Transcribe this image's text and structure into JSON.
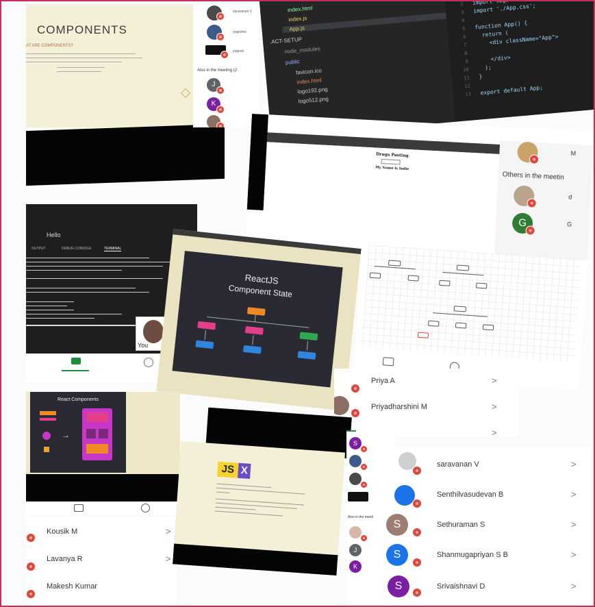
{
  "collage": {
    "components_slide": {
      "title": "COMPONENTS",
      "subtitle": "AT ARE COMPONENTS?",
      "participants": [
        "saravanan V",
        "yogeshw",
        "yogesh"
      ],
      "others_label": "Also in the meeting (2"
    },
    "vscode": {
      "files": [
        "index.html",
        "index.js",
        "App.js",
        ".ACT-SETUP",
        "node_modules",
        "public",
        "favicon.ico",
        "index.html",
        "logo192.png",
        "logo512.png"
      ],
      "code_lines": [
        "import React from 'react';",
        "import logo from './logo.svg",
        "import './App.css';",
        "",
        "function App() {",
        "  return (",
        "    <div className=\"App\">",
        "",
        "    </div>",
        "  );",
        "}",
        "",
        "export default App;"
      ],
      "line_numbers": [
        "1",
        "2",
        "3",
        "4",
        "5",
        "6",
        "7",
        "8",
        "9",
        "10",
        "11",
        "12",
        "13"
      ]
    },
    "browser_meeting": {
      "page_heading": "Drugs Pasting",
      "page_text": "My Name is Indie",
      "others_label": "Others in the meetin",
      "participant_initial": "G",
      "participant_name_m": "M",
      "participant_name_d": "d",
      "participant_name_g": "G"
    },
    "terminal": {
      "title": "Hello",
      "tabs": [
        "OUTPUT",
        "DEBUG CONSOLE",
        "TERMINAL"
      ],
      "you_label": "You"
    },
    "reactjs_state": {
      "title_line1": "ReactJS",
      "title_line2": "Component State"
    },
    "react_components": {
      "title": "React Components"
    },
    "jsx_slide": {
      "logo_left": "JS",
      "logo_right": "X"
    },
    "participants_right": [
      {
        "initial": "",
        "name": "Priya A"
      },
      {
        "initial": "P",
        "name": "Priyadharshini M"
      },
      {
        "initial": "",
        "name": ""
      }
    ],
    "participants_left": [
      {
        "name": "Kousik M"
      },
      {
        "name": "Lavanya R"
      },
      {
        "name": "Makesh Kumar"
      }
    ],
    "participants_bottom_right": [
      {
        "initial": "",
        "name": "saravanan V"
      },
      {
        "initial": "",
        "name": "Senthilvasudevan B"
      },
      {
        "initial": "S",
        "name": "Sethuraman S"
      },
      {
        "initial": "S",
        "name": "Shanmugapriyan S B"
      },
      {
        "initial": "S",
        "name": "Srivaishnavi D"
      }
    ],
    "mini_list": {
      "initials": [
        "S",
        "",
        ""
      ],
      "others_label": "Also in the meeti",
      "initials_lower": [
        "",
        "J",
        "K"
      ]
    },
    "top_left_initials": [
      "J",
      "K"
    ],
    "colors": {
      "border": "#c0305a",
      "mute_red": "#e0463a",
      "avatar_green": "#2e7d32",
      "avatar_blue": "#1a73e8",
      "avatar_purple": "#7b1fa2",
      "avatar_grey": "#5f6368",
      "avatar_taupe": "#9c7d73"
    }
  }
}
